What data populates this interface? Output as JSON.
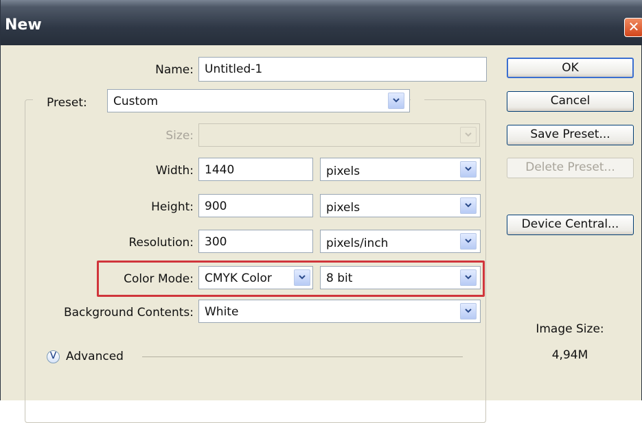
{
  "window": {
    "title": "New",
    "close_glyph": "✕"
  },
  "form": {
    "name": {
      "label": "Name:",
      "value": "Untitled-1"
    },
    "preset": {
      "label": "Preset:",
      "value": "Custom"
    },
    "size": {
      "label": "Size:",
      "value": ""
    },
    "width": {
      "label": "Width:",
      "value": "1440",
      "unit": "pixels"
    },
    "height": {
      "label": "Height:",
      "value": "900",
      "unit": "pixels"
    },
    "resolution": {
      "label": "Resolution:",
      "value": "300",
      "unit": "pixels/inch"
    },
    "color_mode": {
      "label": "Color Mode:",
      "value": "CMYK Color",
      "bit_depth": "8 bit"
    },
    "background": {
      "label": "Background Contents:",
      "value": "White"
    },
    "advanced": {
      "label": "Advanced",
      "icon": "chevron-double-down-icon"
    }
  },
  "buttons": {
    "ok": "OK",
    "cancel": "Cancel",
    "save_preset": "Save Preset...",
    "delete_preset": "Delete Preset...",
    "device_central": "Device Central..."
  },
  "image_size": {
    "label": "Image Size:",
    "value": "4,94M"
  },
  "colors": {
    "titlebar": "#2f3846",
    "dialog_bg": "#ece9d8",
    "highlight_border": "#d0353b",
    "default_button_border": "#3a6ed0"
  }
}
